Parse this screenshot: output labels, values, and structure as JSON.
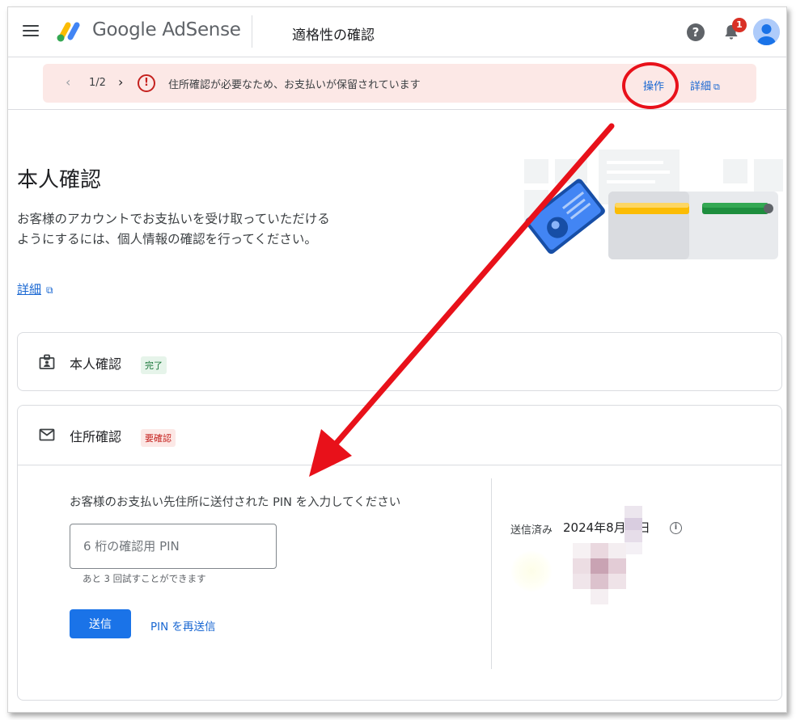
{
  "header": {
    "brand": "Google AdSense",
    "page_title": "適格性の確認",
    "help_icon": "?",
    "notification_count": "1",
    "icons": [
      "menu-icon",
      "adsense-logo",
      "help-icon",
      "bell-icon",
      "avatar-icon"
    ]
  },
  "banner": {
    "pager": "1/2",
    "error_mark": "!",
    "message": "住所確認が必要なため、お支払いが保留されています",
    "action": "操作",
    "details": "詳細",
    "details_icon": "⧉",
    "background": "#fce8e6",
    "highlight_color": "#e8111a"
  },
  "intro": {
    "title": "本人確認",
    "description": "お客様のアカウントでお支払いを受け取っていただけるようにするには、個人情報の確認を行ってください。",
    "learn_more": "詳細",
    "learn_more_icon": "⧉"
  },
  "identity_card": {
    "title": "本人確認",
    "status": "完了",
    "icon": "id-badge-icon"
  },
  "address_card": {
    "title": "住所確認",
    "status": "要確認",
    "icon": "mail-icon",
    "instruction": "お客様のお支払い先住所に送付された PIN を入力してください",
    "pin_placeholder": "6 桁の確認用 PIN",
    "pin_value": "",
    "attempts_left": "あと 3 回試すことができます",
    "submit": "送信",
    "resend": "PIN を再送信",
    "sent_label": "送信済み",
    "sent_date": "2024年8月　日",
    "info_icon": "i"
  },
  "colors": {
    "primary": "#1a73e8",
    "link": "#1967d2",
    "ok_chip_bg": "#e6f4ea",
    "ok_chip_fg": "#137333",
    "need_chip_bg": "#fce8e6",
    "need_chip_fg": "#c5221f",
    "arrow": "#e8111a"
  }
}
